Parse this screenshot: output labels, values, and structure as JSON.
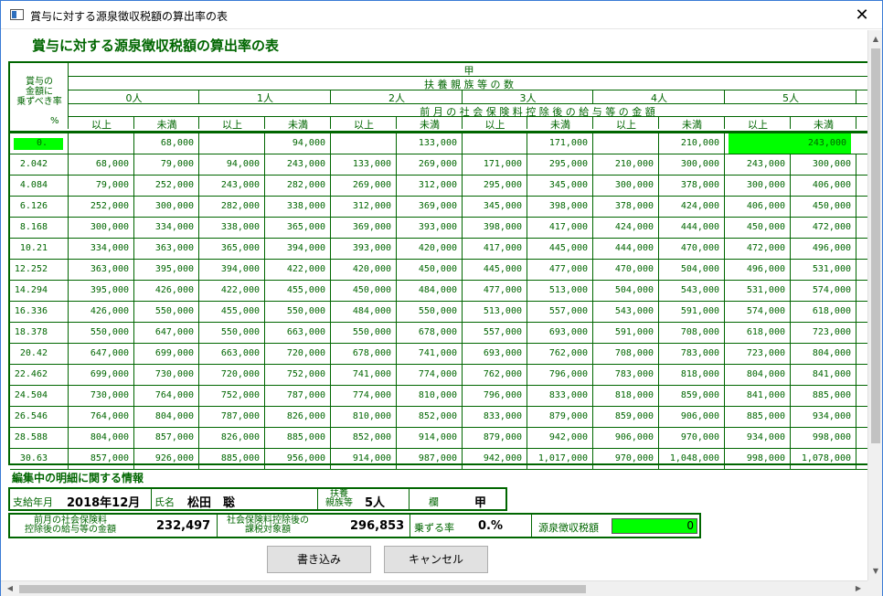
{
  "window": {
    "title": "賞与に対する源泉徴収税額の算出率の表",
    "close": "✕"
  },
  "heading": "賞与に対する源泉徴収税額の算出率の表",
  "header": {
    "left_label": "賞与の\n金額に\n乗ずべき率",
    "percent": "%",
    "kou": "甲",
    "fuyou": "扶 養 親 族 等 の 数",
    "persons": [
      "0人",
      "1人",
      "2人",
      "3人",
      "4人",
      "5人"
    ],
    "zengetsu": "前 月 の 社 会 保 険 料 控 除 後 の 給 与 等 の 金 額",
    "ijou": "以上",
    "miman": "未満"
  },
  "rows": [
    {
      "rate": "0.",
      "v": [
        "",
        "68,000",
        "",
        "94,000",
        "",
        "133,000",
        "",
        "171,000",
        "",
        "210,000",
        "",
        "243,000"
      ]
    },
    {
      "rate": "2.042",
      "v": [
        "68,000",
        "79,000",
        "94,000",
        "243,000",
        "133,000",
        "269,000",
        "171,000",
        "295,000",
        "210,000",
        "300,000",
        "243,000",
        "300,000"
      ]
    },
    {
      "rate": "4.084",
      "v": [
        "79,000",
        "252,000",
        "243,000",
        "282,000",
        "269,000",
        "312,000",
        "295,000",
        "345,000",
        "300,000",
        "378,000",
        "300,000",
        "406,000"
      ]
    },
    {
      "rate": "6.126",
      "v": [
        "252,000",
        "300,000",
        "282,000",
        "338,000",
        "312,000",
        "369,000",
        "345,000",
        "398,000",
        "378,000",
        "424,000",
        "406,000",
        "450,000"
      ]
    },
    {
      "rate": "8.168",
      "v": [
        "300,000",
        "334,000",
        "338,000",
        "365,000",
        "369,000",
        "393,000",
        "398,000",
        "417,000",
        "424,000",
        "444,000",
        "450,000",
        "472,000"
      ]
    },
    {
      "rate": "10.21",
      "v": [
        "334,000",
        "363,000",
        "365,000",
        "394,000",
        "393,000",
        "420,000",
        "417,000",
        "445,000",
        "444,000",
        "470,000",
        "472,000",
        "496,000"
      ]
    },
    {
      "rate": "12.252",
      "v": [
        "363,000",
        "395,000",
        "394,000",
        "422,000",
        "420,000",
        "450,000",
        "445,000",
        "477,000",
        "470,000",
        "504,000",
        "496,000",
        "531,000"
      ]
    },
    {
      "rate": "14.294",
      "v": [
        "395,000",
        "426,000",
        "422,000",
        "455,000",
        "450,000",
        "484,000",
        "477,000",
        "513,000",
        "504,000",
        "543,000",
        "531,000",
        "574,000"
      ]
    },
    {
      "rate": "16.336",
      "v": [
        "426,000",
        "550,000",
        "455,000",
        "550,000",
        "484,000",
        "550,000",
        "513,000",
        "557,000",
        "543,000",
        "591,000",
        "574,000",
        "618,000"
      ]
    },
    {
      "rate": "18.378",
      "v": [
        "550,000",
        "647,000",
        "550,000",
        "663,000",
        "550,000",
        "678,000",
        "557,000",
        "693,000",
        "591,000",
        "708,000",
        "618,000",
        "723,000"
      ]
    },
    {
      "rate": "20.42",
      "v": [
        "647,000",
        "699,000",
        "663,000",
        "720,000",
        "678,000",
        "741,000",
        "693,000",
        "762,000",
        "708,000",
        "783,000",
        "723,000",
        "804,000"
      ]
    },
    {
      "rate": "22.462",
      "v": [
        "699,000",
        "730,000",
        "720,000",
        "752,000",
        "741,000",
        "774,000",
        "762,000",
        "796,000",
        "783,000",
        "818,000",
        "804,000",
        "841,000"
      ]
    },
    {
      "rate": "24.504",
      "v": [
        "730,000",
        "764,000",
        "752,000",
        "787,000",
        "774,000",
        "810,000",
        "796,000",
        "833,000",
        "818,000",
        "859,000",
        "841,000",
        "885,000"
      ]
    },
    {
      "rate": "26.546",
      "v": [
        "764,000",
        "804,000",
        "787,000",
        "826,000",
        "810,000",
        "852,000",
        "833,000",
        "879,000",
        "859,000",
        "906,000",
        "885,000",
        "934,000"
      ]
    },
    {
      "rate": "28.588",
      "v": [
        "804,000",
        "857,000",
        "826,000",
        "885,000",
        "852,000",
        "914,000",
        "879,000",
        "942,000",
        "906,000",
        "970,000",
        "934,000",
        "998,000"
      ]
    },
    {
      "rate": "30.63",
      "v": [
        "857,000",
        "926,000",
        "885,000",
        "956,000",
        "914,000",
        "987,000",
        "942,000",
        "1,017,000",
        "970,000",
        "1,048,000",
        "998,000",
        "1,078,000"
      ]
    }
  ],
  "info": {
    "title": "編集中の明細に関する情報",
    "pay_label": "支給年月",
    "pay_value": "2018年12月",
    "name_label": "氏名",
    "name_value": "松田　聡",
    "fuyou_label": "扶養\n親族等",
    "fuyou_value": "5人",
    "ran_label": "欄",
    "ran_value": "甲",
    "prev_label": "前月の社会保険料\n控除後の給与等の金額",
    "prev_value": "232,497",
    "taxable_label": "社会保険料控除後の\n課税対象額",
    "taxable_value": "296,853",
    "rate_label": "乗ずる率",
    "rate_value": "0.%",
    "tax_label": "源泉徴収税額",
    "tax_value": "0"
  },
  "buttons": {
    "write": "書き込み",
    "cancel": "キャンセル"
  },
  "colors": {
    "accent": "#006600",
    "highlight": "#00ff00"
  }
}
